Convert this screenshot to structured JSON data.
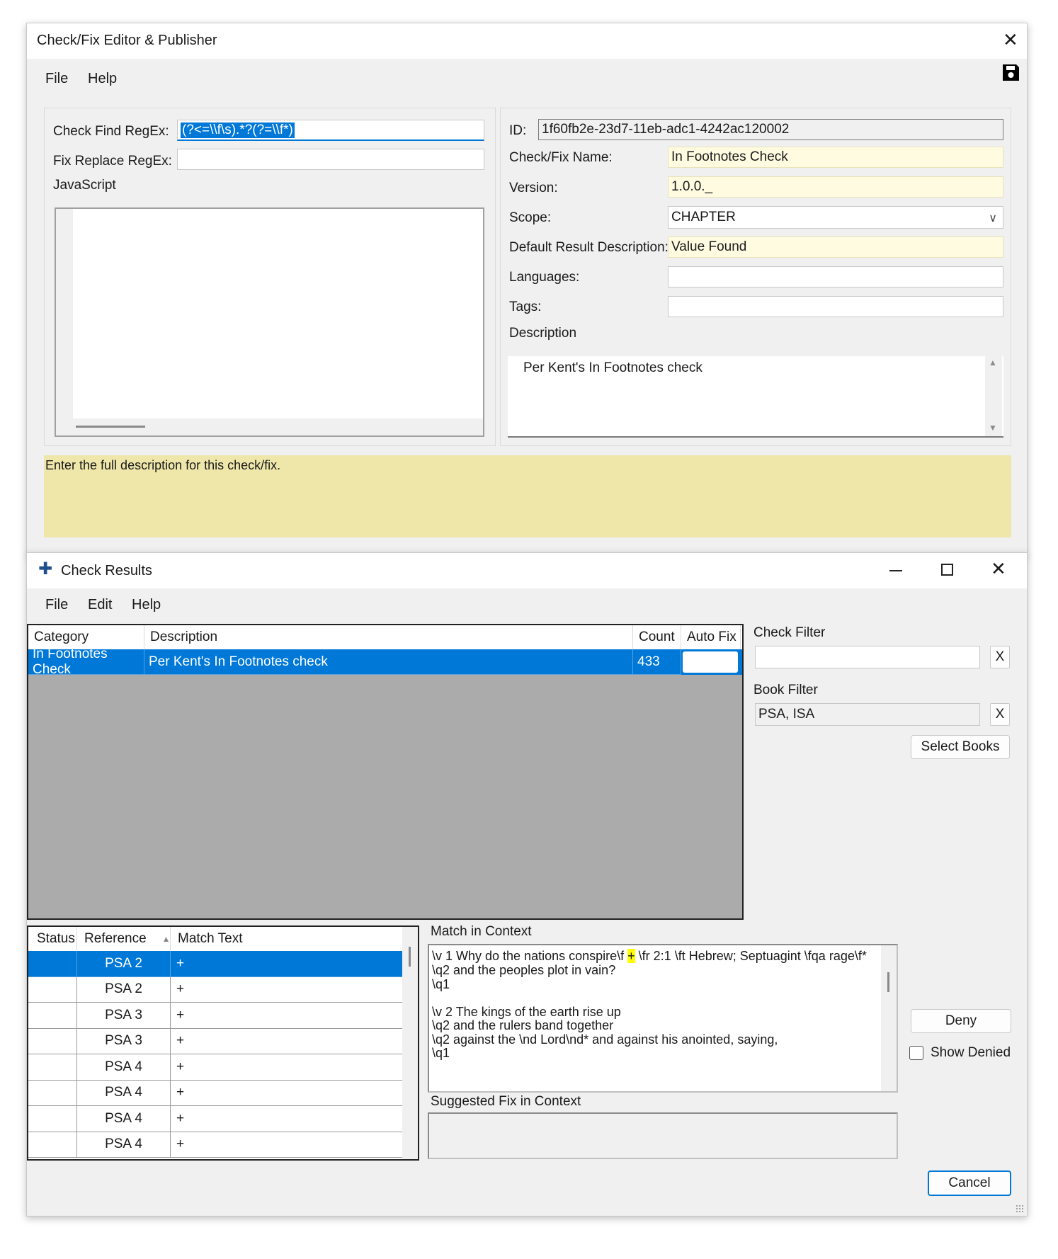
{
  "editor": {
    "title": "Check/Fix Editor & Publisher",
    "close_glyph": "✕",
    "menu": [
      "File",
      "Help"
    ],
    "save_icon": "save-icon",
    "check_find_label": "Check Find RegEx:",
    "check_find_value": "(?<=\\\\f\\s).*?(?=\\\\f*)",
    "fix_replace_label": "Fix Replace RegEx:",
    "fix_replace_value": "",
    "javascript_label": "JavaScript",
    "id_label": "ID:",
    "id_value": "1f60fb2e-23d7-11eb-adc1-4242ac120002",
    "name_label": "Check/Fix Name:",
    "name_value": "In Footnotes Check",
    "version_label": "Version:",
    "version_value": "1.0.0._",
    "scope_label": "Scope:",
    "scope_value": "CHAPTER",
    "default_desc_label": "Default Result Description:",
    "default_desc_value": "Value Found",
    "languages_label": "Languages:",
    "languages_value": "",
    "tags_label": "Tags:",
    "tags_value": "",
    "description_label": "Description",
    "description_value": "Per Kent's In Footnotes check",
    "help_text": "Enter the full description for this check/fix."
  },
  "results": {
    "title": "Check Results",
    "menu": [
      "File",
      "Edit",
      "Help"
    ],
    "summary_columns": [
      "Category",
      "Description",
      "Count",
      "Auto Fix"
    ],
    "summary_rows": [
      {
        "category": "In Footnotes Check",
        "description": "Per Kent's In Footnotes check",
        "count": "433",
        "auto_fix": ""
      }
    ],
    "check_filter_label": "Check Filter",
    "check_filter_value": "",
    "clear_label": "X",
    "book_filter_label": "Book Filter",
    "book_filter_value": "PSA, ISA",
    "select_books_label": "Select Books",
    "detail_columns": [
      "Status",
      "Reference",
      "Match Text"
    ],
    "detail_rows": [
      {
        "status": "",
        "reference": "PSA 2",
        "match": "+"
      },
      {
        "status": "",
        "reference": "PSA 2",
        "match": "+"
      },
      {
        "status": "",
        "reference": "PSA 3",
        "match": "+"
      },
      {
        "status": "",
        "reference": "PSA 3",
        "match": "+"
      },
      {
        "status": "",
        "reference": "PSA 4",
        "match": "+"
      },
      {
        "status": "",
        "reference": "PSA 4",
        "match": "+"
      },
      {
        "status": "",
        "reference": "PSA 4",
        "match": "+"
      },
      {
        "status": "",
        "reference": "PSA 4",
        "match": "+"
      }
    ],
    "match_context_label": "Match in Context",
    "context_line1_before": "\\v 1 Why do the nations conspire\\f ",
    "context_line1_highlight": "+",
    "context_line1_after": " \\fr 2:1 \\ft Hebrew; Septuagint \\fqa rage\\f*",
    "context_rest": "\\q2 and the peoples plot in vain?\n\\q1\n\n\\v 2 The kings of the earth rise up\n\\q2 and the rulers band together\n\\q2 against the \\nd Lord\\nd* and against his anointed, saying,\n\\q1",
    "suggested_fix_label": "Suggested Fix in Context",
    "deny_label": "Deny",
    "show_denied_label": "Show Denied",
    "cancel_label": "Cancel"
  },
  "colors": {
    "selection": "#0078d7",
    "help_panel": "#efe6aa",
    "required_field": "#fffbe0",
    "grid_empty": "#ababab"
  }
}
